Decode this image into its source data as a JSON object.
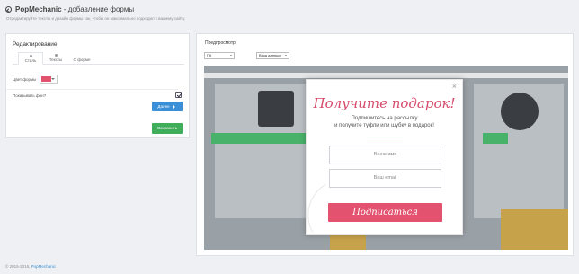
{
  "header": {
    "brand": "PopMechanic",
    "title_rest": " - добавление формы",
    "subtitle": "Отредактируйте тексты и дизайн формы так, чтобы он максимально подходил к вашему сайту."
  },
  "editor": {
    "title": "Редактирование",
    "tabs": [
      {
        "label": "Стиль",
        "active": true
      },
      {
        "label": "Тексты",
        "active": false
      },
      {
        "label": "О форме",
        "active": false
      }
    ],
    "form_color_label": "Цвет формы",
    "form_color": "#e3526f",
    "show_bg_label": "Показывать фон?",
    "show_bg_checked": true,
    "next_button": "Далее",
    "save_button": "Сохранить"
  },
  "preview": {
    "title": "Предпросмотр",
    "device_select": "ПК",
    "trigger_select": "Вход данных",
    "popup": {
      "title": "Получите подарок!",
      "line1": "Подпишитесь на рассылку",
      "line2": "и получите туфли или шубку в подарок!",
      "name_placeholder": "Ваше имя",
      "email_placeholder": "Ваш email",
      "submit": "Подписаться"
    }
  },
  "footer": {
    "copyright": "© 2015-2016,",
    "link": "PopMechanic"
  },
  "colors": {
    "accent_pink": "#e3526f",
    "primary_blue": "#3b8fd6",
    "save_green": "#3fae5a"
  }
}
